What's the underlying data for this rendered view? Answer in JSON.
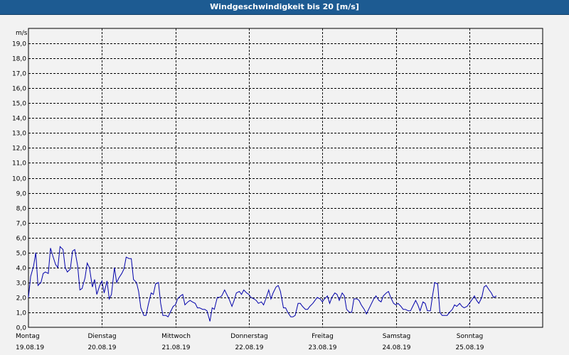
{
  "window": {
    "title": "Windgeschwindigkeit bis 20 [m/s]"
  },
  "chart_data": {
    "type": "line",
    "title": "Windgeschwindigkeit bis 20 [m/s]",
    "ylabel": "m/s",
    "ylim": [
      0,
      20
    ],
    "xlim": [
      0,
      7
    ],
    "y_ticks": [
      "0,0",
      "1,0",
      "2,0",
      "3,0",
      "4,0",
      "5,0",
      "6,0",
      "7,0",
      "8,0",
      "9,0",
      "10,0",
      "11,0",
      "12,0",
      "13,0",
      "14,0",
      "15,0",
      "16,0",
      "17,0",
      "18,0",
      "19,0"
    ],
    "x_ticks": [
      {
        "day": "Montag",
        "date": "19.08.19"
      },
      {
        "day": "Dienstag",
        "date": "20.08.19"
      },
      {
        "day": "Mittwoch",
        "date": "21.08.19"
      },
      {
        "day": "Donnerstag",
        "date": "22.08.19"
      },
      {
        "day": "Freitag",
        "date": "23.08.19"
      },
      {
        "day": "Samstag",
        "date": "24.08.19"
      },
      {
        "day": "Sonntag",
        "date": "25.08.19"
      }
    ],
    "grid": true,
    "series_color": "#0000aa",
    "x": [
      0,
      0.03,
      0.07,
      0.1,
      0.13,
      0.17,
      0.2,
      0.23,
      0.27,
      0.3,
      0.33,
      0.37,
      0.4,
      0.43,
      0.47,
      0.5,
      0.53,
      0.57,
      0.6,
      0.63,
      0.67,
      0.7,
      0.73,
      0.77,
      0.8,
      0.83,
      0.87,
      0.9,
      0.93,
      0.97,
      1.0,
      1.03,
      1.07,
      1.1,
      1.13,
      1.17,
      1.2,
      1.23,
      1.27,
      1.3,
      1.33,
      1.37,
      1.4,
      1.43,
      1.47,
      1.5,
      1.53,
      1.57,
      1.6,
      1.63,
      1.67,
      1.7,
      1.73,
      1.77,
      1.8,
      1.83,
      1.87,
      1.9,
      1.93,
      1.97,
      2.0,
      2.03,
      2.07,
      2.1,
      2.13,
      2.17,
      2.2,
      2.23,
      2.27,
      2.3,
      2.33,
      2.37,
      2.4,
      2.43,
      2.47,
      2.5,
      2.53,
      2.57,
      2.6,
      2.63,
      2.67,
      2.7,
      2.73,
      2.77,
      2.8,
      2.83,
      2.87,
      2.9,
      2.93,
      2.97,
      3.0,
      3.03,
      3.07,
      3.1,
      3.13,
      3.17,
      3.2,
      3.23,
      3.27,
      3.3,
      3.33,
      3.37,
      3.4,
      3.43,
      3.47,
      3.5,
      3.53,
      3.57,
      3.6,
      3.63,
      3.67,
      3.7,
      3.73,
      3.77,
      3.8,
      3.83,
      3.87,
      3.9,
      3.93,
      3.97,
      4.0,
      4.03,
      4.07,
      4.1,
      4.13,
      4.17,
      4.2,
      4.23,
      4.27,
      4.3,
      4.33,
      4.37,
      4.4,
      4.43,
      4.47,
      4.5,
      4.53,
      4.57,
      4.6,
      4.63,
      4.67,
      4.7,
      4.73,
      4.77,
      4.8,
      4.83,
      4.87,
      4.9,
      4.93,
      4.97,
      5.0,
      5.03,
      5.07,
      5.1,
      5.13,
      5.17,
      5.2,
      5.23,
      5.27,
      5.3,
      5.33,
      5.37,
      5.4,
      5.43,
      5.47,
      5.5,
      5.53,
      5.57,
      5.6,
      5.63,
      5.67,
      5.7,
      5.73,
      5.77,
      5.8,
      5.83,
      5.87,
      5.9,
      5.93,
      5.97,
      6.0,
      6.03,
      6.07,
      6.1,
      6.13,
      6.17,
      6.2,
      6.23,
      6.27,
      6.3,
      6.33,
      6.37,
      6.4,
      6.43,
      6.47,
      6.5,
      6.53,
      6.57,
      6.6,
      6.63,
      6.67,
      6.7,
      6.73,
      6.77,
      6.8,
      6.83,
      6.87,
      6.9,
      6.93,
      6.97
    ],
    "y": [
      2.0,
      3.4,
      4.1,
      5.0,
      2.8,
      3.0,
      3.6,
      3.7,
      3.6,
      5.3,
      4.8,
      4.2,
      4.0,
      5.4,
      5.2,
      4.0,
      3.7,
      3.9,
      5.1,
      5.2,
      4.1,
      2.5,
      2.6,
      3.3,
      4.3,
      4.0,
      2.7,
      3.2,
      2.2,
      2.8,
      3.1,
      2.3,
      3.1,
      1.9,
      2.2,
      4.0,
      3.0,
      3.3,
      3.6,
      3.9,
      4.7,
      4.6,
      4.6,
      3.2,
      3.0,
      2.4,
      1.3,
      0.8,
      0.8,
      1.5,
      2.3,
      2.2,
      2.9,
      3.0,
      1.6,
      0.8,
      0.8,
      0.7,
      1.0,
      1.4,
      1.5,
      1.9,
      2.1,
      2.2,
      1.5,
      1.7,
      1.8,
      1.7,
      1.6,
      1.3,
      1.3,
      1.2,
      1.2,
      1.1,
      0.4,
      1.3,
      1.2,
      2.0,
      2.0,
      2.1,
      2.5,
      2.2,
      1.9,
      1.4,
      1.8,
      2.3,
      2.4,
      2.2,
      2.5,
      2.3,
      2.2,
      2.0,
      1.9,
      1.8,
      1.6,
      1.7,
      1.5,
      1.9,
      2.5,
      1.9,
      2.3,
      2.7,
      2.8,
      2.4,
      1.3,
      1.3,
      1.0,
      0.7,
      0.7,
      0.8,
      1.6,
      1.6,
      1.4,
      1.2,
      1.2,
      1.4,
      1.6,
      1.8,
      2.0,
      1.9,
      1.7,
      1.9,
      2.1,
      1.6,
      2.0,
      2.3,
      2.2,
      1.8,
      2.3,
      2.1,
      1.2,
      1.0,
      1.0,
      1.9,
      1.9,
      1.8,
      1.5,
      1.2,
      0.9,
      1.2,
      1.6,
      1.9,
      2.1,
      1.8,
      1.7,
      2.1,
      2.3,
      2.4,
      2.0,
      1.6,
      1.5,
      1.6,
      1.4,
      1.2,
      1.2,
      1.1,
      1.1,
      1.4,
      1.8,
      1.5,
      1.1,
      1.7,
      1.6,
      1.1,
      1.1,
      2.1,
      3.0,
      2.9,
      1.0,
      0.8,
      0.8,
      0.8,
      1.0,
      1.2,
      1.5,
      1.4,
      1.6,
      1.4,
      1.3,
      1.4,
      1.6,
      1.8,
      2.1,
      1.8,
      1.6,
      2.0,
      2.7,
      2.8,
      2.5,
      2.3,
      2.0,
      2.1
    ]
  }
}
